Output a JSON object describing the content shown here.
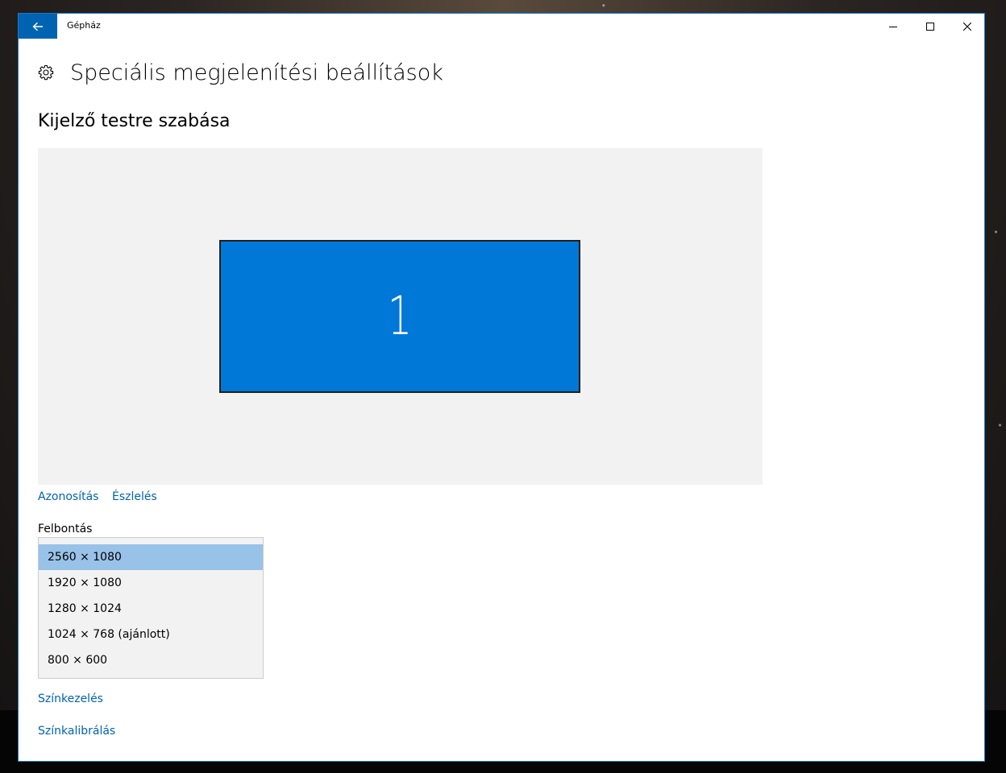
{
  "window": {
    "app_title": "Gépház"
  },
  "titlebar": {
    "back_icon": "arrow-left-icon",
    "minimize_icon": "minimize-icon",
    "maximize_icon": "maximize-icon",
    "close_icon": "close-icon"
  },
  "page": {
    "icon": "gear-icon",
    "title": "Speciális megjelenítési beállítások",
    "section_title": "Kijelző testre szabása"
  },
  "display_preview": {
    "monitor_label": "1",
    "monitor_color": "#0078d7"
  },
  "actions": {
    "identify": "Azonosítás",
    "detect": "Észlelés"
  },
  "resolution": {
    "label": "Felbontás",
    "selected_index": 0,
    "options": [
      "2560 × 1080",
      "1920 × 1080",
      "1280 × 1024",
      "1024 × 768 (ajánlott)",
      "800 × 600"
    ]
  },
  "links": {
    "color_management": "Színkezelés",
    "color_calibration": "Színkalibrálás"
  },
  "colors": {
    "accent": "#0063b1",
    "selection": "#99c2e8",
    "window_border": "#1979ca"
  }
}
